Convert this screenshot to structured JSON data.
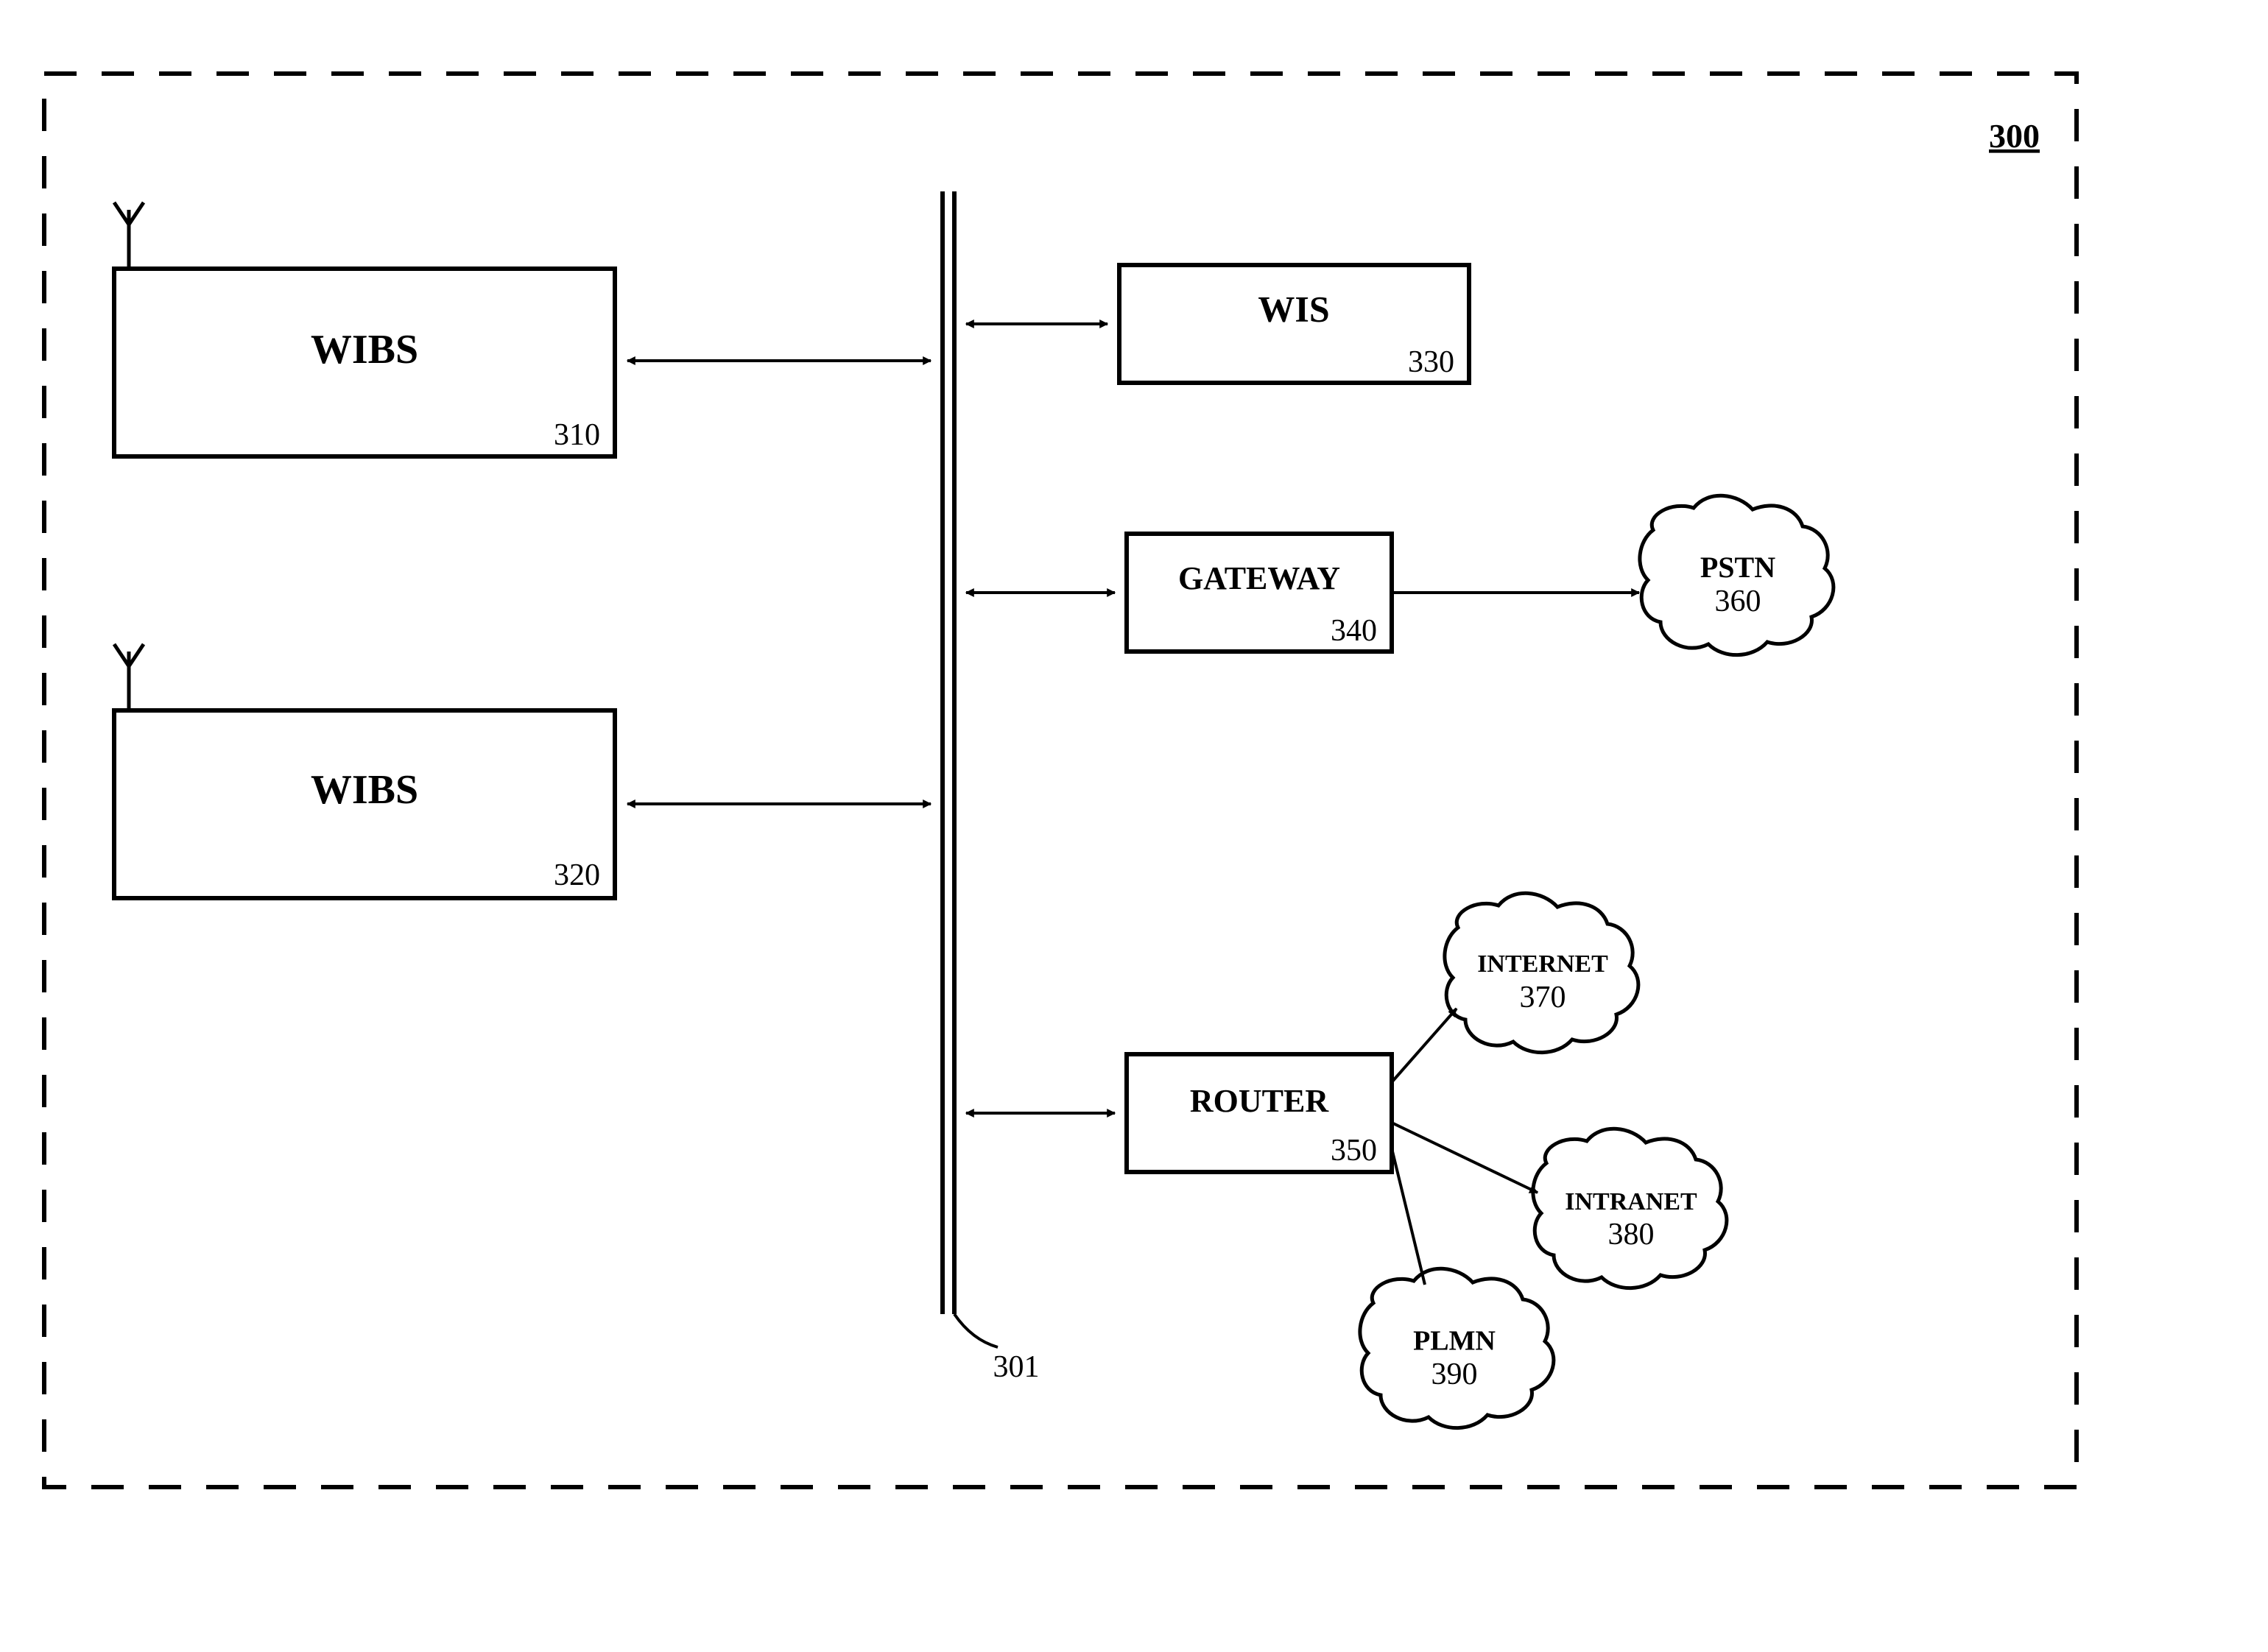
{
  "system_ref": "300",
  "bus_ref": "301",
  "nodes": {
    "wibs1": {
      "label": "WIBS",
      "ref": "310"
    },
    "wibs2": {
      "label": "WIBS",
      "ref": "320"
    },
    "wis": {
      "label": "WIS",
      "ref": "330"
    },
    "gateway": {
      "label": "GATEWAY",
      "ref": "340"
    },
    "router": {
      "label": "ROUTER",
      "ref": "350"
    },
    "pstn": {
      "label": "PSTN",
      "ref": "360"
    },
    "internet": {
      "label": "INTERNET",
      "ref": "370"
    },
    "intranet": {
      "label": "INTRANET",
      "ref": "380"
    },
    "plmn": {
      "label": "PLMN",
      "ref": "390"
    }
  }
}
